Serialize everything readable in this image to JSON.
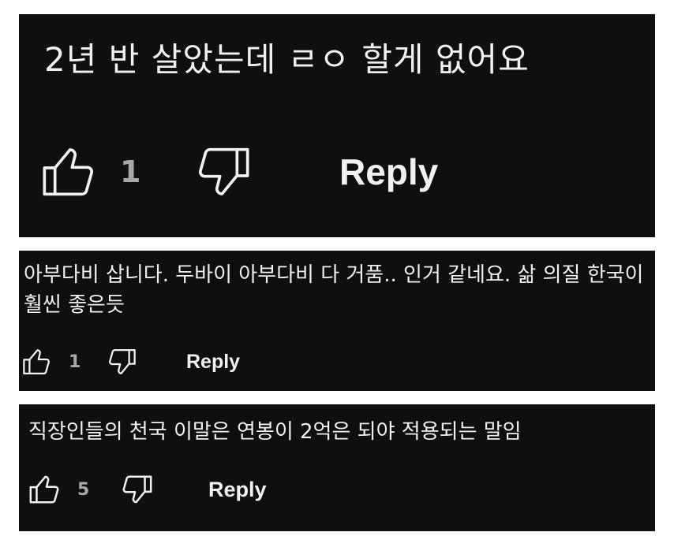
{
  "colors": {
    "card_background": "#0f0f0f",
    "text": "#f1f1f1",
    "count_text": "#a8a8a8",
    "page_background": "#ffffff"
  },
  "comments": [
    {
      "text": "2년 반 살았는데 ㄹㅇ 할게 없어요",
      "like_count": "1",
      "reply_label": "Reply",
      "like_icon": "thumbs-up-icon",
      "dislike_icon": "thumbs-down-icon"
    },
    {
      "text": "아부다비 삽니다. 두바이 아부다비 다 거품.. 인거 같네요. 삶 의질 한국이 훨씬 좋은듯",
      "like_count": "1",
      "reply_label": "Reply",
      "like_icon": "thumbs-up-icon",
      "dislike_icon": "thumbs-down-icon"
    },
    {
      "text": "직장인들의 천국 이말은 연봉이 2억은 되야 적용되는 말임",
      "like_count": "5",
      "reply_label": "Reply",
      "like_icon": "thumbs-up-icon",
      "dislike_icon": "thumbs-down-icon"
    }
  ]
}
